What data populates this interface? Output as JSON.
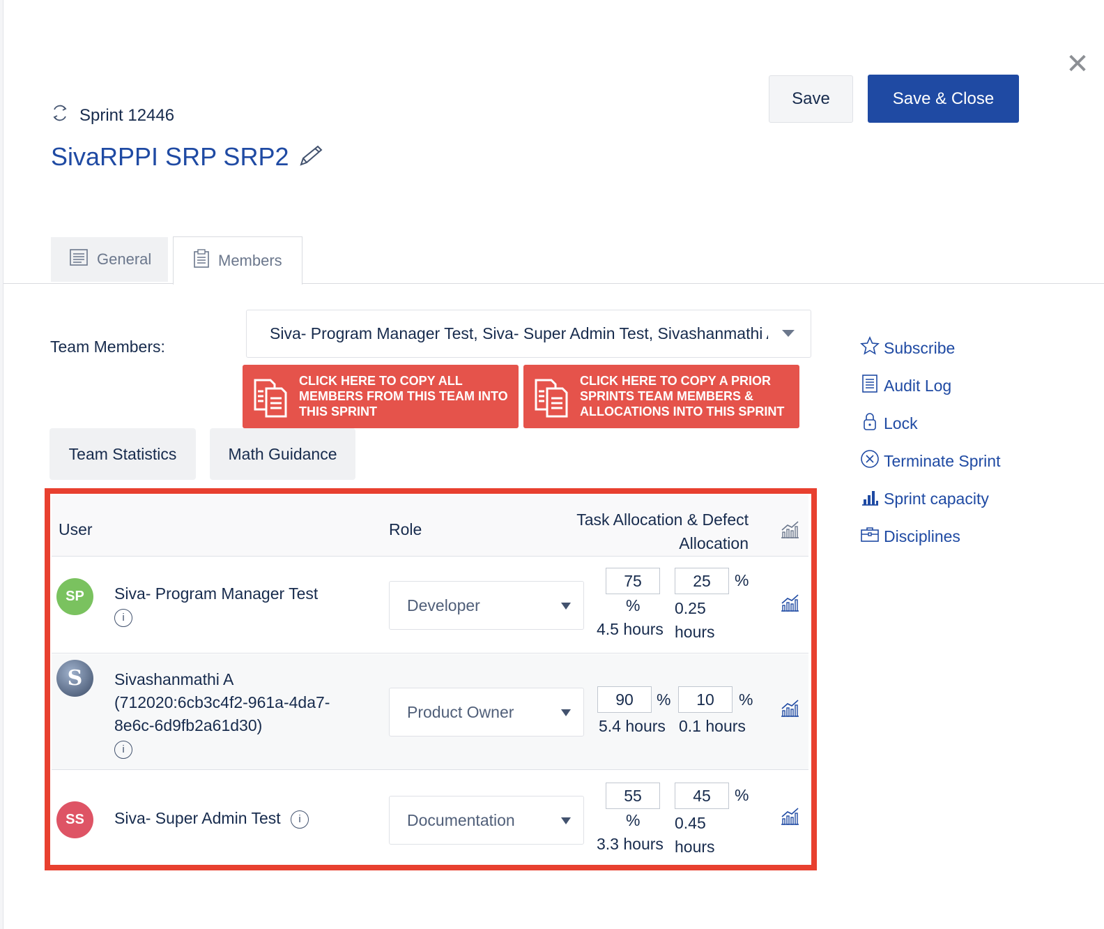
{
  "sprint": {
    "label": "Sprint 12446",
    "title": "SivaRPPI SRP SRP2"
  },
  "toolbar": {
    "save": "Save",
    "save_close": "Save & Close"
  },
  "tabs": [
    {
      "label": "General",
      "icon": "document-icon"
    },
    {
      "label": "Members",
      "icon": "clipboard-icon",
      "active": true
    }
  ],
  "team_members": {
    "label": "Team Members:",
    "value": "Siva- Program Manager Test, Siva- Super Admin Test, Sivashanmathi A"
  },
  "copy_buttons": {
    "copy_team": "CLICK HERE TO COPY ALL MEMBERS FROM THIS TEAM INTO THIS SPRINT",
    "copy_prior": "CLICK HERE TO COPY A PRIOR SPRINTS TEAM MEMBERS & ALLOCATIONS INTO THIS SPRINT"
  },
  "actions": {
    "team_statistics": "Team Statistics",
    "math_guidance": "Math Guidance"
  },
  "table": {
    "headers": {
      "user": "User",
      "role": "Role",
      "allocation": "Task Allocation & Defect Allocation"
    },
    "rows": [
      {
        "initials": "SP",
        "avatar_color": "#7ac25f",
        "name": "Siva- Program Manager Test",
        "role": "Developer",
        "task_pct": "75",
        "defect_pct": "25",
        "percent": "%",
        "task_hours": "4.5 hours",
        "defect_hours": "0.25 hours"
      },
      {
        "initials": "S",
        "avatar_color": "#5b6f8f",
        "name": "Sivashanmathi A (712020:6cb3c4f2-961a-4da7-8e6c-6d9fb2a61d30)",
        "role": "Product Owner",
        "task_pct": "90",
        "defect_pct": "10",
        "percent": "%",
        "task_hours": "5.4 hours",
        "defect_hours": "0.1 hours"
      },
      {
        "initials": "SS",
        "avatar_color": "#de5465",
        "name": "Siva- Super Admin Test",
        "role": "Documentation",
        "task_pct": "55",
        "defect_pct": "45",
        "percent": "%",
        "task_hours": "3.3 hours",
        "defect_hours": "0.45 hours"
      }
    ]
  },
  "right_menu": [
    {
      "label": "Subscribe",
      "icon": "star-icon"
    },
    {
      "label": "Audit Log",
      "icon": "log-icon"
    },
    {
      "label": "Lock",
      "icon": "lock-icon"
    },
    {
      "label": "Terminate Sprint",
      "icon": "terminate-icon"
    },
    {
      "label": "Sprint capacity",
      "icon": "capacity-icon"
    },
    {
      "label": "Disciplines",
      "icon": "briefcase-icon"
    }
  ],
  "colors": {
    "primary": "#1f4aa3",
    "danger": "#e5534b",
    "highlight_border": "#e8402f"
  }
}
